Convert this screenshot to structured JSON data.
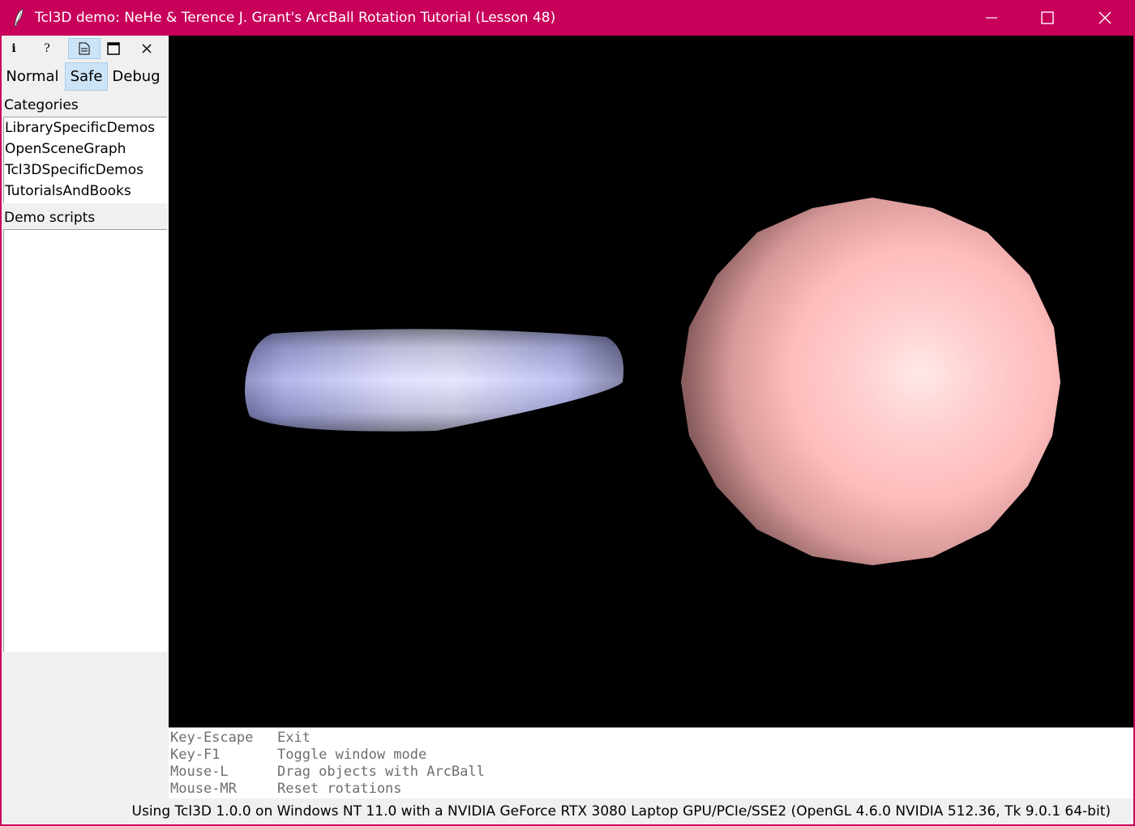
{
  "window": {
    "title": "Tcl3D demo: NeHe & Terence J. Grant's ArcBall Rotation Tutorial (Lesson 48)",
    "app_icon": "feather-icon",
    "controls": [
      "minimize-icon",
      "maximize-icon",
      "close-icon"
    ]
  },
  "toolbar": {
    "info_label": "i",
    "help_label": "?",
    "icons": [
      "info-icon",
      "help-icon",
      "document-icon",
      "window-icon",
      "close-icon"
    ]
  },
  "modes": {
    "normal": "Normal",
    "safe": "Safe",
    "debug": "Debug",
    "selected": "Safe"
  },
  "categories": {
    "label": "Categories",
    "items": [
      "LibrarySpecificDemos",
      "OpenSceneGraph",
      "Tcl3DSpecificDemos",
      "TutorialsAndBooks"
    ]
  },
  "demo_scripts": {
    "label": "Demo scripts",
    "items": []
  },
  "scene": {
    "torus_color": "#c8c8ff",
    "sphere_color": "#ffbcbc",
    "background": "#000000"
  },
  "help": [
    {
      "key": "Key-Escape",
      "action": "Exit"
    },
    {
      "key": "Key-F1",
      "action": "Toggle window mode"
    },
    {
      "key": "Mouse-L",
      "action": "Drag objects with ArcBall"
    },
    {
      "key": "Mouse-MR",
      "action": "Reset rotations"
    }
  ],
  "status": "Using Tcl3D 1.0.0 on Windows NT 11.0 with a NVIDIA GeForce RTX 3080 Laptop GPU/PCIe/SSE2 (OpenGL 4.6.0 NVIDIA 512.36, Tk 9.0.1 64-bit)",
  "colors": {
    "titlebar": "#c8005a",
    "selected": "#cce4f7"
  }
}
